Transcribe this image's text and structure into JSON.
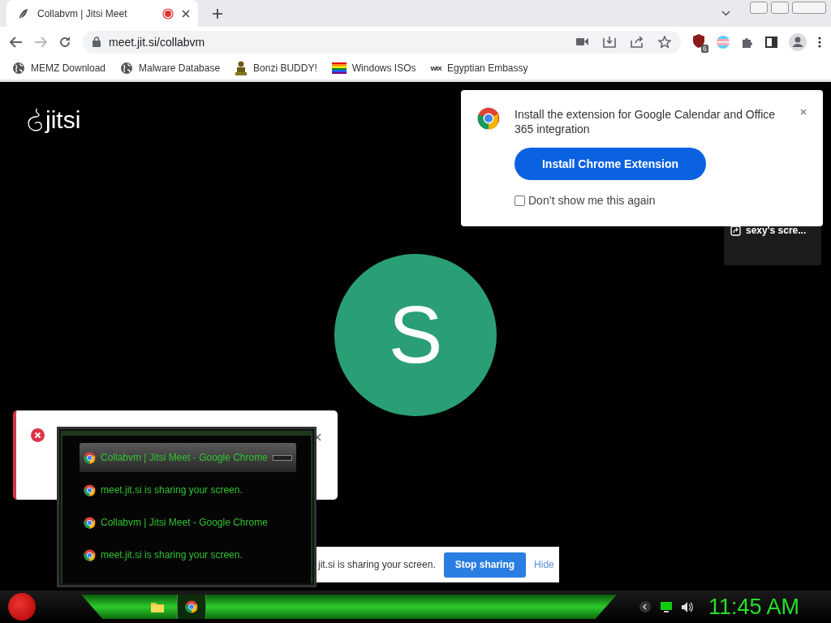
{
  "browser": {
    "tabs": [
      {
        "title": "Collabvm | Jitsi Meet",
        "recording": true,
        "selected": true
      }
    ],
    "address": "meet.jit.si/collabvm",
    "extension_badge": "6",
    "bookmarks": [
      {
        "kind": "globe",
        "label": "MEMZ Download"
      },
      {
        "kind": "globe",
        "label": "Malware Database"
      },
      {
        "kind": "figure",
        "label": "Bonzi BUDDY!"
      },
      {
        "kind": "flag",
        "label": "Windows ISOs"
      },
      {
        "kind": "wordmark",
        "mark": "WIX",
        "label": "Egyptian Embassy"
      }
    ]
  },
  "meeting": {
    "logo": "jitsi",
    "avatar_letter": "S",
    "tile_label": "sexy's scre..."
  },
  "extension_prompt": {
    "message": "Install the extension for Google Calendar and Office 365 integration",
    "button": "Install Chrome Extension",
    "checkbox": {
      "label": "Don’t show me this again",
      "checked": false
    }
  },
  "task_switcher": {
    "items": [
      {
        "title": "Collabvm | Jitsi Meet - Google Chrome",
        "selected": true
      },
      {
        "title": "meet.jit.si is sharing your screen.",
        "selected": false
      },
      {
        "title": "Collabvm | Jitsi Meet - Google Chrome",
        "selected": false
      },
      {
        "title": "meet.jit.si is sharing your screen.",
        "selected": false
      }
    ]
  },
  "share_bar": {
    "message": "jit.si is sharing your screen.",
    "stop_button": "Stop sharing",
    "hide_link": "Hide"
  },
  "taskbar": {
    "apps": [
      {
        "kind": "folder",
        "selected": false
      },
      {
        "kind": "chrome",
        "selected": true
      }
    ],
    "clock": "11:45 AM"
  }
}
